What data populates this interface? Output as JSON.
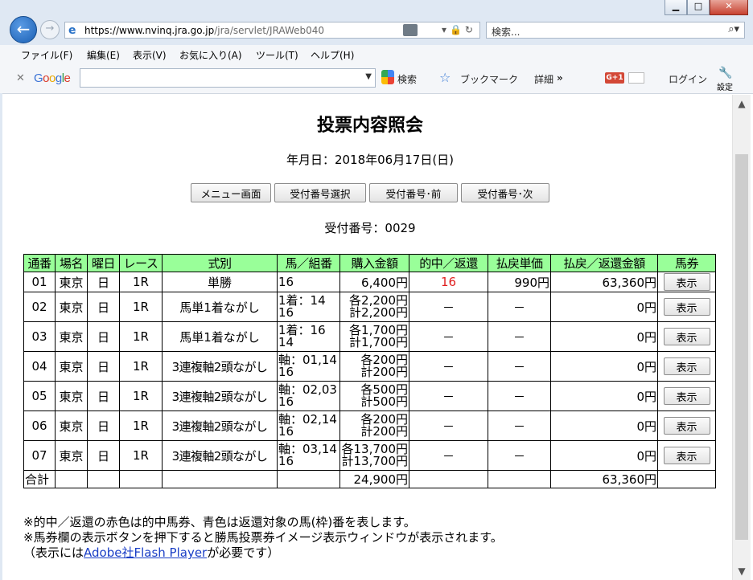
{
  "browser": {
    "url_host": "https://www.nvinq.jra.go.jp",
    "url_path": "/jra/servlet/JRAWeb040",
    "search_placeholder": "検索...",
    "menu": [
      "ファイル(F)",
      "編集(E)",
      "表示(V)",
      "お気に入り(A)",
      "ツール(T)",
      "ヘルプ(H)"
    ],
    "google": {
      "search_label": "検索",
      "bookmark_label": "ブックマーク",
      "details_label": "詳細",
      "more": "»",
      "gplus": "G+1",
      "login_label": "ログイン",
      "settings_label": "設定"
    }
  },
  "page": {
    "title": "投票内容照会",
    "date_line": "年月日：2018年06月17日(日)",
    "buttons": [
      "メニュー画面",
      "受付番号選択",
      "受付番号･前",
      "受付番号･次"
    ],
    "receipt_line": "受付番号：0029",
    "table": {
      "headers": [
        "通番",
        "場名",
        "曜日",
        "レース",
        "式別",
        "馬／組番",
        "購入金額",
        "的中／返還",
        "払戻単価",
        "払戻／返還金額",
        "馬券"
      ],
      "rows": [
        {
          "no": "01",
          "venue": "東京",
          "day": "日",
          "race": "1R",
          "type": "単勝",
          "combo1": "16",
          "combo2": "",
          "amt1": "6,400円",
          "amt2": "",
          "hit": "16",
          "unit": "990円",
          "payout": "63,360円",
          "btn": "表示"
        },
        {
          "no": "02",
          "venue": "東京",
          "day": "日",
          "race": "1R",
          "type": "馬単1着ながし",
          "combo1": "1着：14",
          "combo2": "16",
          "amt1": "各2,200円",
          "amt2": "計2,200円",
          "hit": "－",
          "unit": "－",
          "payout": "0円",
          "btn": "表示"
        },
        {
          "no": "03",
          "venue": "東京",
          "day": "日",
          "race": "1R",
          "type": "馬単1着ながし",
          "combo1": "1着：16",
          "combo2": "14",
          "amt1": "各1,700円",
          "amt2": "計1,700円",
          "hit": "－",
          "unit": "－",
          "payout": "0円",
          "btn": "表示"
        },
        {
          "no": "04",
          "venue": "東京",
          "day": "日",
          "race": "1R",
          "type": "3連複軸2頭ながし",
          "combo1": "軸：01,14",
          "combo2": "16",
          "amt1": "各200円",
          "amt2": "計200円",
          "hit": "－",
          "unit": "－",
          "payout": "0円",
          "btn": "表示"
        },
        {
          "no": "05",
          "venue": "東京",
          "day": "日",
          "race": "1R",
          "type": "3連複軸2頭ながし",
          "combo1": "軸：02,03",
          "combo2": "16",
          "amt1": "各500円",
          "amt2": "計500円",
          "hit": "－",
          "unit": "－",
          "payout": "0円",
          "btn": "表示"
        },
        {
          "no": "06",
          "venue": "東京",
          "day": "日",
          "race": "1R",
          "type": "3連複軸2頭ながし",
          "combo1": "軸：02,14",
          "combo2": "16",
          "amt1": "各200円",
          "amt2": "計200円",
          "hit": "－",
          "unit": "－",
          "payout": "0円",
          "btn": "表示"
        },
        {
          "no": "07",
          "venue": "東京",
          "day": "日",
          "race": "1R",
          "type": "3連複軸2頭ながし",
          "combo1": "軸：03,14",
          "combo2": "16",
          "amt1": "各13,700円",
          "amt2": "計13,700円",
          "hit": "－",
          "unit": "－",
          "payout": "0円",
          "btn": "表示"
        }
      ],
      "total": {
        "label": "合計",
        "purchase": "24,900円",
        "payout": "63,360円"
      }
    },
    "notes": [
      "※的中／返還の赤色は的中馬券、青色は返還対象の馬(枠)番を表します。",
      "※馬券欄の表示ボタンを押下すると勝馬投票券イメージ表示ウィンドウが表示されます。"
    ],
    "note3_prefix": "（表示には",
    "note3_link": "Adobe社Flash Player",
    "note3_suffix": "が必要です）"
  },
  "colors": {
    "header_bg": "#99ff99",
    "hit_red": "#e02020",
    "link_blue": "#1a3ec6"
  }
}
